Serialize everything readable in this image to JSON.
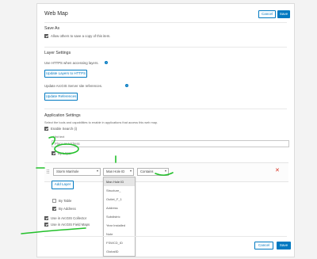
{
  "title": "Web Map",
  "header": {
    "cancel_label": "Cancel",
    "save_label": "Save"
  },
  "save_as": {
    "heading": "Save As",
    "allow_copy_label": "Allow others to save a copy of this item."
  },
  "layer_settings": {
    "heading": "Layer Settings",
    "https_label": "Use HTTPS when accessing layers.",
    "update_https_button": "Update Layers to HTTPS",
    "update_refs_label": "Update ArcGIS Server site references.",
    "update_refs_button": "Update References"
  },
  "app_settings": {
    "heading": "Application Settings",
    "description": "Select the tools and capabilities to enable in applications that access this web map.",
    "enable_search_label": "Enable Search (i)",
    "hint_label": "Hint text",
    "hint_placeholder": "Place or Address",
    "by_layer_label": "By Layer",
    "layer_select": "Storm Manhole",
    "field_select": "Man Hole ID",
    "match_select": "Contains",
    "add_layer_button": "Add Layer",
    "by_table_label": "By Table",
    "by_address_label": "By Address",
    "collector_label": "Use in ArcGIS Collector",
    "field_maps_label": "Use in ArcGIS Field Maps"
  },
  "field_dropdown_options": [
    "Man Hole ID",
    "Structure_",
    "Outlet_F_1",
    "Address",
    "Subdistric",
    "Year Installed",
    "Note",
    "FSWCD_ID",
    "GlobalID"
  ],
  "footer": {
    "cancel_label": "Cancel",
    "save_label": "Save"
  },
  "colors": {
    "accent": "#0079c1",
    "annotation": "#22c02a",
    "remove": "#d83020"
  }
}
